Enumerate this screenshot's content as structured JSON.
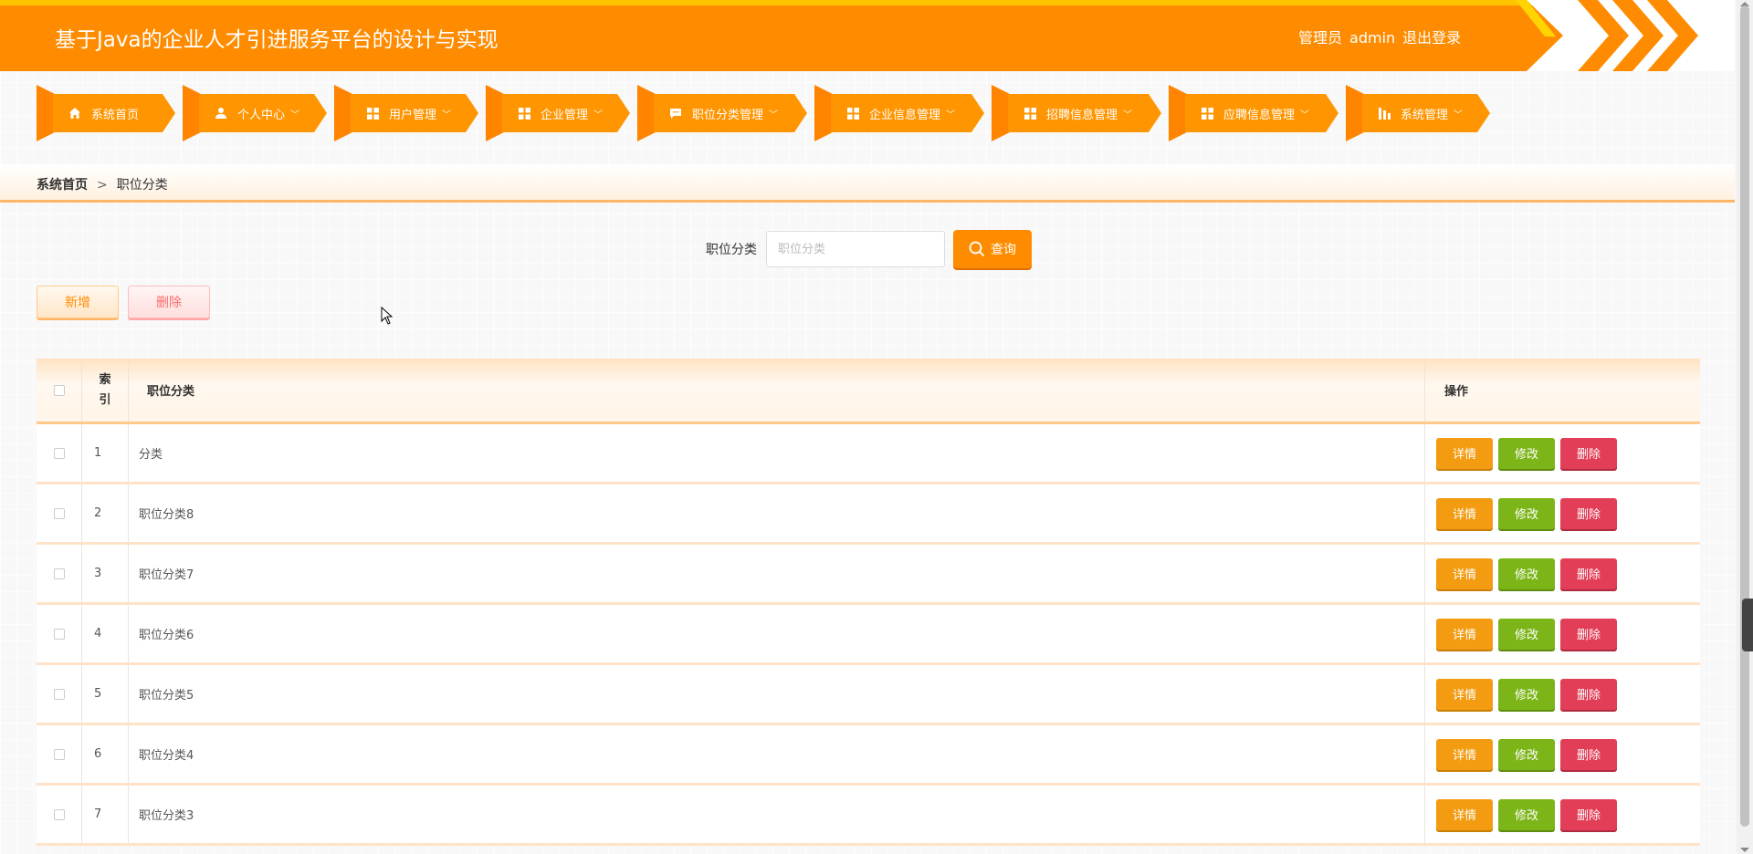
{
  "header": {
    "title": "基于Java的企业人才引进服务平台的设计与实现",
    "user_role": "管理员",
    "username": "admin",
    "logout_label": "退出登录"
  },
  "nav": {
    "items": [
      {
        "label": "系统首页",
        "icon": "home-icon",
        "dropdown": false
      },
      {
        "label": "个人中心",
        "icon": "user-icon",
        "dropdown": true
      },
      {
        "label": "用户管理",
        "icon": "grid-icon",
        "dropdown": true
      },
      {
        "label": "企业管理",
        "icon": "grid-icon",
        "dropdown": true
      },
      {
        "label": "职位分类管理",
        "icon": "chat-icon",
        "dropdown": true
      },
      {
        "label": "企业信息管理",
        "icon": "grid-icon",
        "dropdown": true
      },
      {
        "label": "招聘信息管理",
        "icon": "grid-icon",
        "dropdown": true
      },
      {
        "label": "应聘信息管理",
        "icon": "grid-icon",
        "dropdown": true
      },
      {
        "label": "系统管理",
        "icon": "chart-icon",
        "dropdown": true
      }
    ]
  },
  "breadcrumb": {
    "home": "系统首页",
    "separator": ">",
    "current": "职位分类"
  },
  "search": {
    "label": "职位分类",
    "placeholder": "职位分类",
    "value": "",
    "button_label": "查询"
  },
  "actions": {
    "add_label": "新增",
    "delete_label": "删除"
  },
  "table": {
    "headers": {
      "index": "索引",
      "name": "职位分类",
      "ops": "操作"
    },
    "rows": [
      {
        "index": "1",
        "name": "分类"
      },
      {
        "index": "2",
        "name": "职位分类8"
      },
      {
        "index": "3",
        "name": "职位分类7"
      },
      {
        "index": "4",
        "name": "职位分类6"
      },
      {
        "index": "5",
        "name": "职位分类5"
      },
      {
        "index": "6",
        "name": "职位分类4"
      },
      {
        "index": "7",
        "name": "职位分类3"
      }
    ],
    "op_labels": {
      "detail": "详情",
      "edit": "修改",
      "delete": "删除"
    }
  },
  "colors": {
    "primary": "#ff8c00",
    "accent_yellow": "#ffc400",
    "detail": "#f39c12",
    "edit": "#7cb518",
    "delete": "#e23e57"
  }
}
